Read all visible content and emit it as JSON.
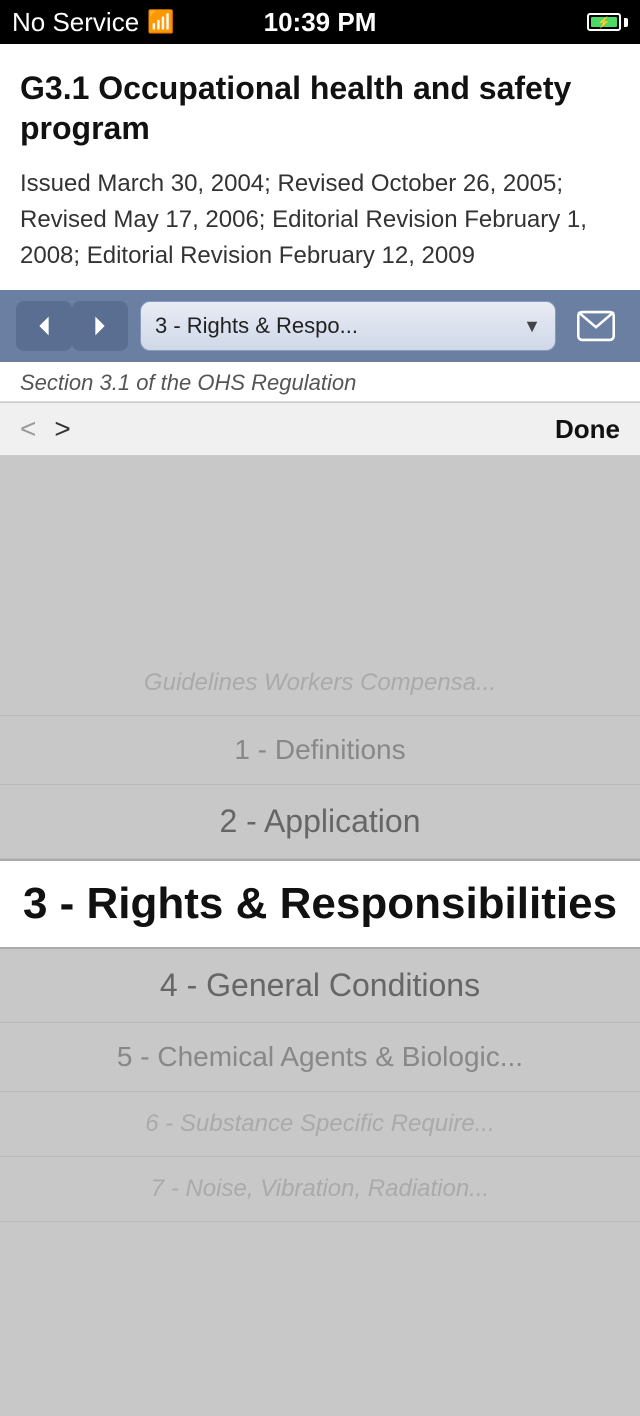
{
  "status_bar": {
    "signal": "No Service",
    "wifi": "wifi",
    "time": "10:39 PM",
    "battery_pct": 100
  },
  "document": {
    "title": "G3.1 Occupational health and safety program",
    "meta": "Issued March 30, 2004; Revised October 26, 2005; Revised May 17, 2006; Editorial Revision February 1, 2008; Editorial Revision February 12, 2009"
  },
  "nav_toolbar": {
    "back_label": "←",
    "forward_label": "→",
    "selected_section": "3 - Rights & Respo...",
    "mail_label": "mail"
  },
  "partial_text": "Section 3.1 of the OHS Regulation",
  "browser_nav": {
    "back_label": "<",
    "forward_label": ">",
    "done_label": "Done"
  },
  "picker": {
    "items": [
      {
        "label": "Guidelines Workers Compensa...",
        "state": "faded"
      },
      {
        "label": "1 - Definitions",
        "state": "dim"
      },
      {
        "label": "2 - Application",
        "state": "medium"
      },
      {
        "label": "3 - Rights & Responsibilities",
        "state": "selected"
      },
      {
        "label": "4 - General Conditions",
        "state": "medium"
      },
      {
        "label": "5 - Chemical Agents & Biologic...",
        "state": "dim"
      },
      {
        "label": "6 - Substance Specific Require...",
        "state": "faded"
      },
      {
        "label": "7 - Noise, Vibration, Radiation...",
        "state": "faded"
      }
    ]
  }
}
